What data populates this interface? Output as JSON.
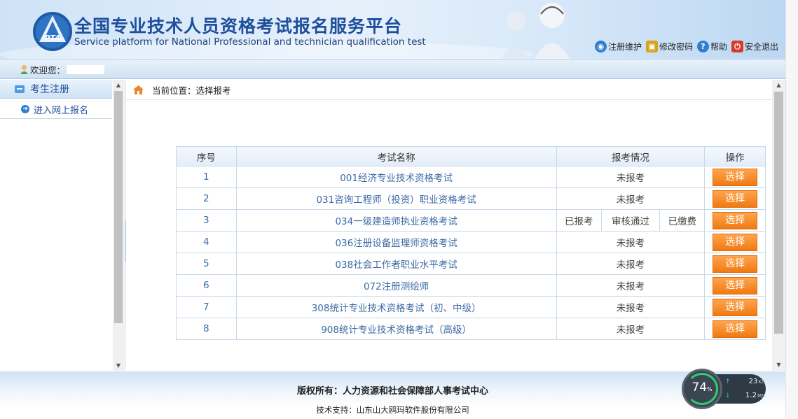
{
  "header": {
    "logo_text": "PTA",
    "title": "全国专业技术人员资格考试报名服务平台",
    "subtitle": "Service platform for National Professional and technician qualification test",
    "links": [
      {
        "label": "注册维护",
        "icon": "globe-icon",
        "color": "#2f7fd1"
      },
      {
        "label": "修改密码",
        "icon": "lock-icon",
        "color": "#d9a21a"
      },
      {
        "label": "帮助",
        "icon": "help-icon",
        "color": "#2f7fd1"
      },
      {
        "label": "安全退出",
        "icon": "power-icon",
        "color": "#d83a2a"
      }
    ]
  },
  "welcome": {
    "label": "欢迎您："
  },
  "sidebar": {
    "section_label": "考生注册",
    "items": [
      {
        "label": "进入网上报名"
      }
    ]
  },
  "breadcrumb": {
    "text": "当前位置：选择报考"
  },
  "table": {
    "headers": {
      "no": "序号",
      "name": "考试名称",
      "status": "报考情况",
      "action": "操作"
    },
    "rows": [
      {
        "no": "1",
        "name": "001经济专业技术资格考试",
        "status": "未报考"
      },
      {
        "no": "2",
        "name": "031咨询工程师（投资）职业资格考试",
        "status": "未报考"
      },
      {
        "no": "3",
        "name": "034一级建造师执业资格考试",
        "status_parts": [
          "已报考",
          "审核通过",
          "已缴费"
        ]
      },
      {
        "no": "4",
        "name": "036注册设备监理师资格考试",
        "status": "未报考"
      },
      {
        "no": "5",
        "name": "038社会工作者职业水平考试",
        "status": "未报考"
      },
      {
        "no": "6",
        "name": "072注册测绘师",
        "status": "未报考"
      },
      {
        "no": "7",
        "name": "308统计专业技术资格考试（初、中级）",
        "status": "未报考"
      },
      {
        "no": "8",
        "name": "908统计专业技术资格考试（高级）",
        "status": "未报考"
      }
    ],
    "action_label": "选择"
  },
  "footer": {
    "copyright": "版权所有：人力资源和社会保障部人事考试中心",
    "support": "技术支持：山东山大鸥玛软件股份有限公司"
  },
  "net_widget": {
    "percent": "74",
    "percent_unit": "%",
    "upload": "23",
    "upload_unit": "K/s",
    "download": "1.2",
    "download_unit": "M/s"
  },
  "colors": {
    "accent": "#1d4f9c",
    "button": "#f58a1f",
    "link": "#3a6aa6"
  }
}
